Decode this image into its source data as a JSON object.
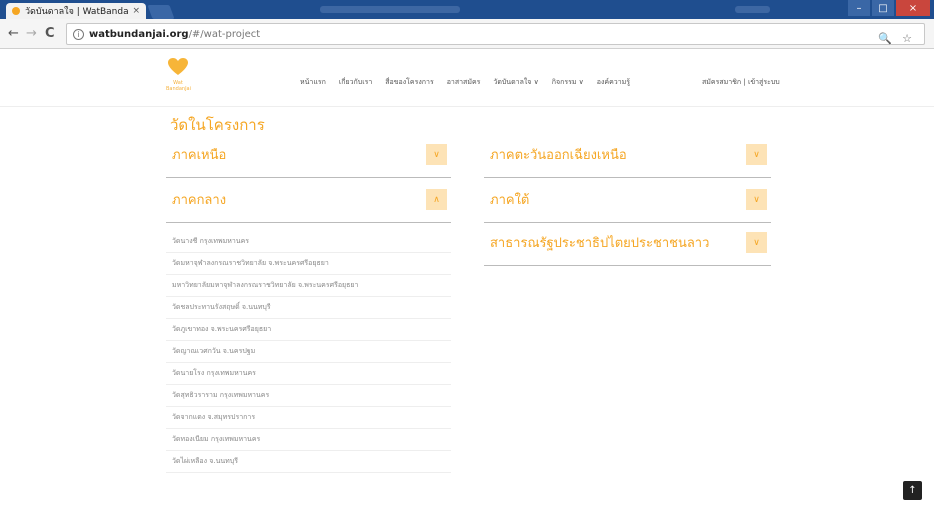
{
  "browser": {
    "tab_title": "วัดบันดาลใจ | WatBandanj",
    "tab_close": "×",
    "url_domain": "watbundanjai.org",
    "url_path": "/#/wat-project",
    "back": "←",
    "forward": "→",
    "reload": "C",
    "info_icon": "i",
    "zoom_icon": "🔍",
    "star_icon": "☆",
    "win_min": "–",
    "win_max": "□",
    "win_close": "×"
  },
  "header": {
    "logo_text": "Wat BandanJai",
    "nav": [
      "หน้าแรก",
      "เกี่ยวกับเรา",
      "สื่อของโครงการ",
      "อาสาสมัคร",
      "วัดบันดาลใจ ∨",
      "กิจกรรม ∨",
      "องค์ความรู้"
    ],
    "auth": "สมัครสมาชิก | เข้าสู่ระบบ"
  },
  "page_title": "วัดในโครงการ",
  "left_panels": [
    {
      "title": "ภาคเหนือ",
      "toggle": "∨",
      "items": []
    },
    {
      "title": "ภาคกลาง",
      "toggle": "∧",
      "items": [
        "วัดนางชี กรุงเทพมหานคร",
        "วัดมหาจุฬาลงกรณราชวิทยาลัย จ.พระนครศรีอยุธยา",
        "มหาวิทยาลัยมหาจุฬาลงกรณราชวิทยาลัย จ.พระนครศรีอยุธยา",
        "วัดชลประทานรังสฤษดิ์ จ.นนทบุรี",
        "วัดภูเขาทอง จ.พระนครศรีอยุธยา",
        "วัดญาณเวศกวัน จ.นครปฐม",
        "วัดนายโรง กรุงเทพมหานคร",
        "วัดสุทธิวราราม กรุงเทพมหานคร",
        "วัดจากแดง จ.สมุทรปราการ",
        "วัดทองเนียม กรุงเทพมหานคร",
        "วัดไผ่เหลือง จ.นนทบุรี"
      ]
    }
  ],
  "right_panels": [
    {
      "title": "ภาคตะวันออกเฉียงเหนือ",
      "toggle": "∨"
    },
    {
      "title": "ภาคใต้",
      "toggle": "∨"
    },
    {
      "title": "สาธารณรัฐประชาธิปไตยประชาชนลาว",
      "toggle": "∨"
    }
  ],
  "scroll_top": "↑",
  "colors": {
    "accent": "#f5a623",
    "toggle_bg": "#fde3b6",
    "tabbar": "#1f4e8f"
  }
}
